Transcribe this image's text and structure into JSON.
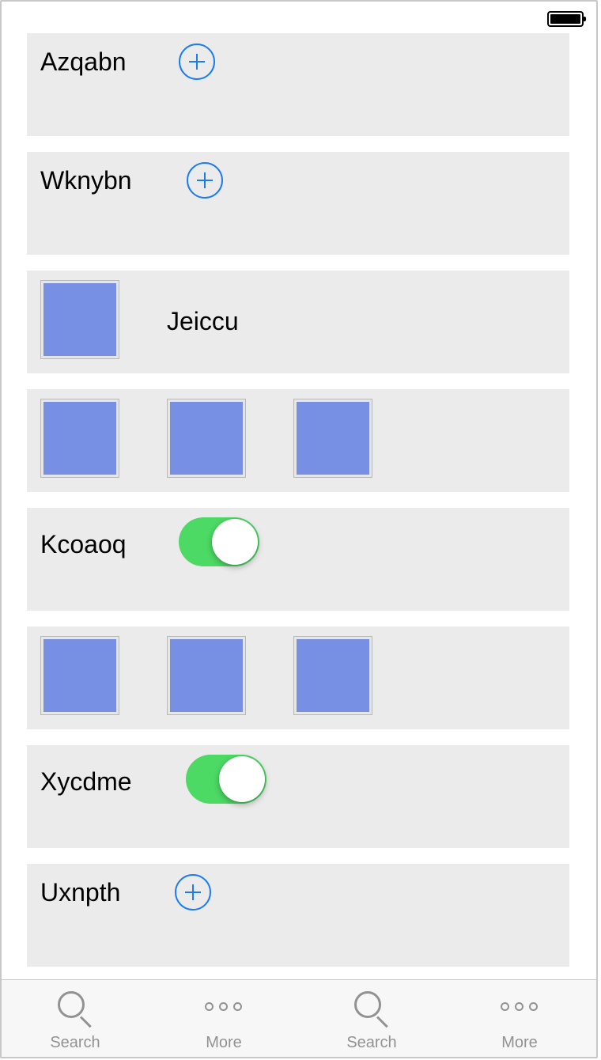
{
  "status_bar": {
    "battery_icon": "battery-full-icon"
  },
  "cells": {
    "c1": {
      "label": "Azqabn",
      "icon": "plus-circle-icon"
    },
    "c2": {
      "label": "Wknybn",
      "icon": "plus-circle-icon"
    },
    "c3": {
      "label": "Jeiccu",
      "image": "image-thumbnail"
    },
    "c5": {
      "label": "Kcoaoq",
      "toggle_on": true
    },
    "c7": {
      "label": "Xycdme",
      "toggle_on": true
    },
    "c8": {
      "label": "Uxnpth",
      "icon": "plus-circle-icon"
    }
  },
  "colors": {
    "accent_blue": "#1a7cf0",
    "toggle_green": "#4cd964",
    "thumbnail_fill": "#7790e4",
    "cell_background": "#ebebeb",
    "tab_gray": "#929292"
  },
  "tabbar": {
    "items": [
      {
        "label": "Search",
        "icon": "search-icon"
      },
      {
        "label": "More",
        "icon": "more-icon"
      },
      {
        "label": "Search",
        "icon": "search-icon"
      },
      {
        "label": "More",
        "icon": "more-icon"
      }
    ]
  }
}
